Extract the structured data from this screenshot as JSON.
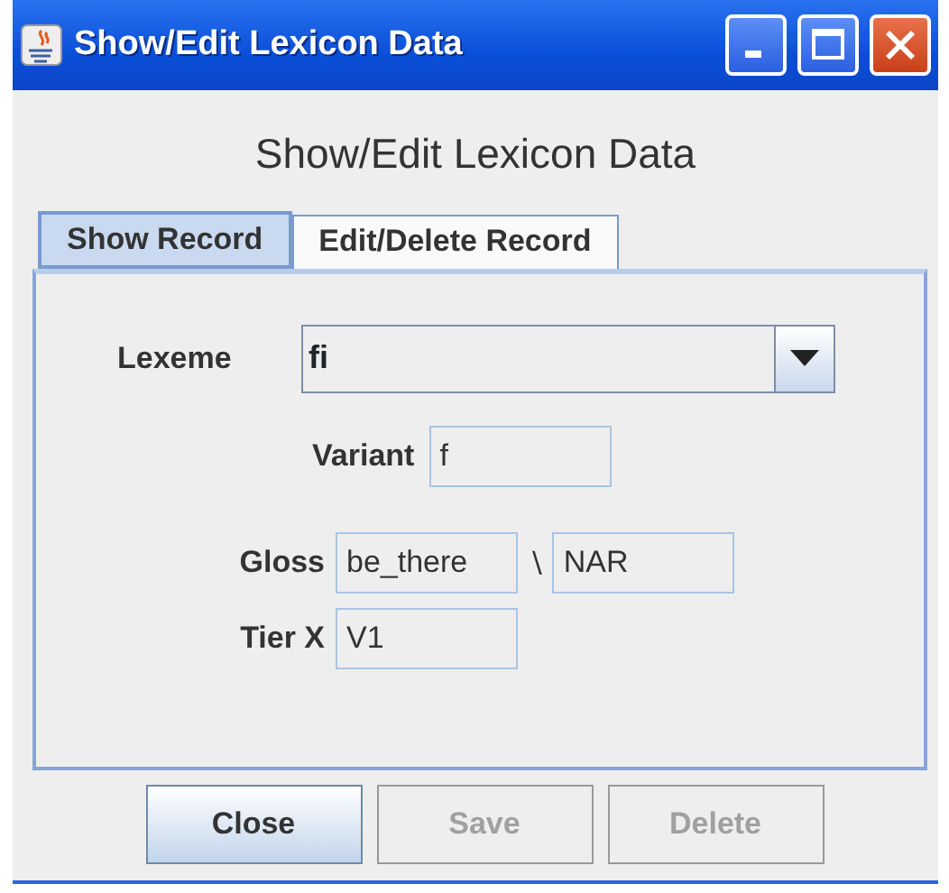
{
  "window": {
    "title": "Show/Edit Lexicon Data"
  },
  "heading": "Show/Edit Lexicon Data",
  "tabs": [
    {
      "label": "Show Record",
      "selected": true
    },
    {
      "label": "Edit/Delete Record",
      "selected": false
    }
  ],
  "lexeme": {
    "label": "Lexeme",
    "value": "fi"
  },
  "variant": {
    "label": "Variant",
    "value": "f"
  },
  "gloss": {
    "label": "Gloss",
    "value": "be_there",
    "separator": "\\",
    "value_2": "NAR"
  },
  "tier_x": {
    "label": "Tier X",
    "value": "V1"
  },
  "buttons": [
    {
      "label": "Close",
      "disabled": false
    },
    {
      "label": "Save",
      "disabled": true
    },
    {
      "label": "Delete",
      "disabled": true
    }
  ]
}
